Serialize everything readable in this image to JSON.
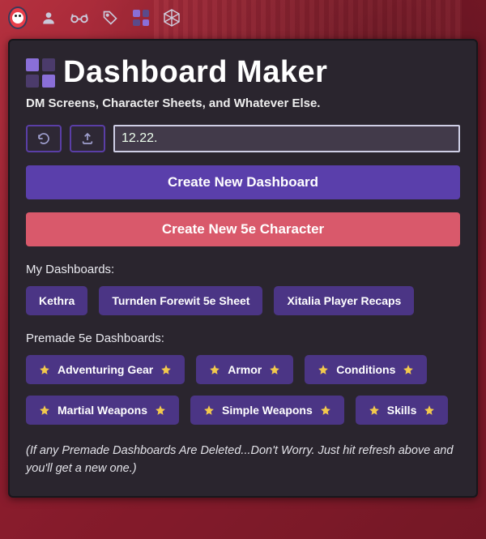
{
  "nav": {
    "icons": [
      "avatar",
      "person",
      "glasses",
      "tag",
      "grid",
      "d20"
    ]
  },
  "header": {
    "title": "Dashboard Maker",
    "subtitle": "DM Screens, Character Sheets, and Whatever Else."
  },
  "toolbar": {
    "refresh_icon": "refresh",
    "upload_icon": "upload",
    "input_value": "12.22."
  },
  "buttons": {
    "create_dashboard": "Create New Dashboard",
    "create_character": "Create New 5e Character"
  },
  "sections": {
    "my_dashboards_label": "My Dashboards:",
    "my_dashboards": [
      {
        "label": "Kethra"
      },
      {
        "label": "Turnden Forewit 5e Sheet"
      },
      {
        "label": "Xitalia Player Recaps"
      }
    ],
    "premade_label": "Premade 5e Dashboards:",
    "premade": [
      {
        "label": "Adventuring Gear"
      },
      {
        "label": "Armor"
      },
      {
        "label": "Conditions"
      },
      {
        "label": "Martial Weapons"
      },
      {
        "label": "Simple Weapons"
      },
      {
        "label": "Skills"
      }
    ]
  },
  "footnote": "(If any Premade Dashboards Are Deleted...Don't Worry. Just hit refresh above and you'll get a new one.)",
  "colors": {
    "panel_bg": "#2a252e",
    "accent_purple": "#5a3fab",
    "accent_red": "#d9596b",
    "pill_purple": "#4b3585",
    "star": "#f2c94c"
  }
}
